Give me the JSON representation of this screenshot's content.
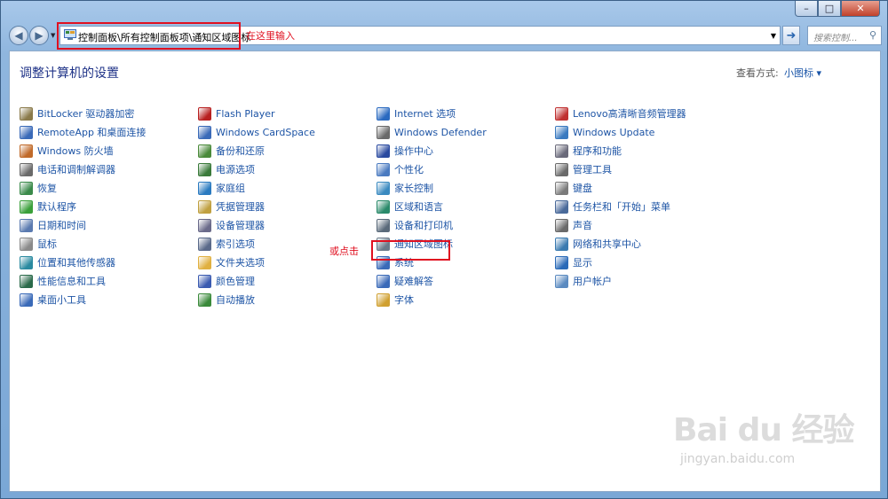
{
  "window": {
    "caption_buttons": {
      "minimize": "–",
      "maximize": "□",
      "close": "✕"
    }
  },
  "nav": {
    "back_icon": "back-arrow-icon",
    "forward_icon": "forward-arrow-icon",
    "address_path": "控制面板\\所有控制面板项\\通知区域图标",
    "go_icon": "go-arrow-icon",
    "search_placeholder": "搜索控制...",
    "search_icon": "magnifier-icon"
  },
  "annotations": {
    "address_hint": "在这里输入",
    "or_click": "或点击"
  },
  "header": {
    "title": "调整计算机的设置",
    "view_label": "查看方式:",
    "view_value": "小图标 ▾"
  },
  "columns": [
    [
      {
        "label": "BitLocker 驱动器加密",
        "color": "#8a7a4a"
      },
      {
        "label": "RemoteApp 和桌面连接",
        "color": "#3a6ab8"
      },
      {
        "label": "Windows 防火墙",
        "color": "#c06a2a"
      },
      {
        "label": "电话和调制解调器",
        "color": "#6a6a6a"
      },
      {
        "label": "恢复",
        "color": "#3a8a4a"
      },
      {
        "label": "默认程序",
        "color": "#3aa03a"
      },
      {
        "label": "日期和时间",
        "color": "#5a7ab0"
      },
      {
        "label": "鼠标",
        "color": "#8a8a8a"
      },
      {
        "label": "位置和其他传感器",
        "color": "#2a8aa0"
      },
      {
        "label": "性能信息和工具",
        "color": "#2a6a4a"
      },
      {
        "label": "桌面小工具",
        "color": "#3a6ab8"
      }
    ],
    [
      {
        "label": "Flash Player",
        "color": "#b82020"
      },
      {
        "label": "Windows CardSpace",
        "color": "#3a6ab8"
      },
      {
        "label": "备份和还原",
        "color": "#4a8a3a"
      },
      {
        "label": "电源选项",
        "color": "#3a7a3a"
      },
      {
        "label": "家庭组",
        "color": "#2a7ac0"
      },
      {
        "label": "凭据管理器",
        "color": "#c0a040"
      },
      {
        "label": "设备管理器",
        "color": "#6a6a8a"
      },
      {
        "label": "索引选项",
        "color": "#5a6a8a"
      },
      {
        "label": "文件夹选项",
        "color": "#e0b040"
      },
      {
        "label": "颜色管理",
        "color": "#3a5ab0"
      },
      {
        "label": "自动播放",
        "color": "#3a8a3a"
      }
    ],
    [
      {
        "label": "Internet 选项",
        "color": "#2a6ac0"
      },
      {
        "label": "Windows Defender",
        "color": "#6a6a6a"
      },
      {
        "label": "操作中心",
        "color": "#2a4aa0"
      },
      {
        "label": "个性化",
        "color": "#4a7ac0"
      },
      {
        "label": "家长控制",
        "color": "#3a8ac0"
      },
      {
        "label": "区域和语言",
        "color": "#2a8a6a"
      },
      {
        "label": "设备和打印机",
        "color": "#5a6a7a"
      },
      {
        "label": "通知区域图标",
        "color": "#6a7a8a"
      },
      {
        "label": "系统",
        "color": "#3a6ab8"
      },
      {
        "label": "疑难解答",
        "color": "#3a6ab8"
      },
      {
        "label": "字体",
        "color": "#d0a030"
      }
    ],
    [
      {
        "label": "Lenovo高清晰音频管理器",
        "color": "#c03030"
      },
      {
        "label": "Windows Update",
        "color": "#3a7ac0"
      },
      {
        "label": "程序和功能",
        "color": "#6a6a7a"
      },
      {
        "label": "管理工具",
        "color": "#6a6a6a"
      },
      {
        "label": "键盘",
        "color": "#7a7a7a"
      },
      {
        "label": "任务栏和「开始」菜单",
        "color": "#4a6a9a"
      },
      {
        "label": "声音",
        "color": "#6a6a6a"
      },
      {
        "label": "网络和共享中心",
        "color": "#3a7ab0"
      },
      {
        "label": "显示",
        "color": "#2a6ab8"
      },
      {
        "label": "用户帐户",
        "color": "#5a8ac0"
      }
    ]
  ],
  "watermark": {
    "main": "Bai du 经验",
    "sub": "jingyan.baidu.com"
  }
}
